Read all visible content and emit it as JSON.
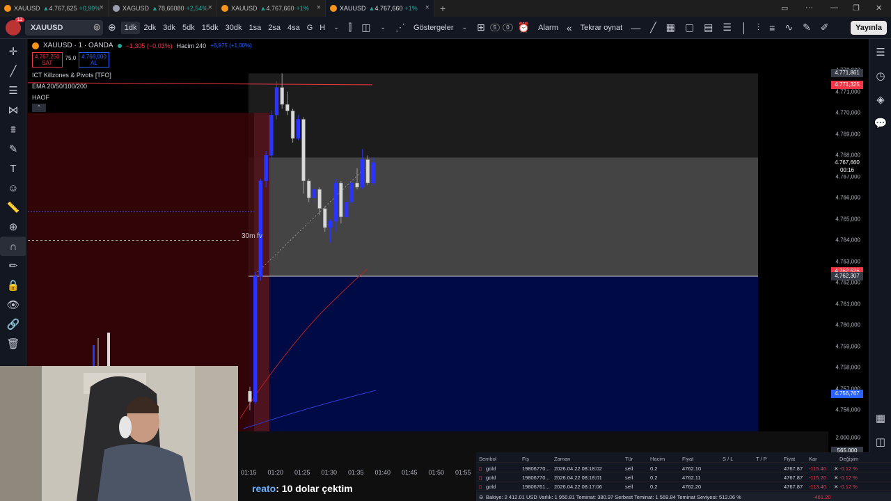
{
  "tabs": [
    {
      "symbol": "XAUUSD",
      "arrow": "▲",
      "price": "4.767,625",
      "change": "+0,99%",
      "active": false
    },
    {
      "symbol": "XAGUSD",
      "arrow": "▲",
      "price": "78,66080",
      "change": "+2,54%",
      "active": false
    },
    {
      "symbol": "XAUUSD",
      "arrow": "▲",
      "price": "4.767,660",
      "change": "+1%",
      "active": false
    },
    {
      "symbol": "XAUUSD",
      "arrow": "▲",
      "price": "4.767,660",
      "change": "+1%",
      "active": true
    }
  ],
  "toolbar": {
    "notification_count": "11",
    "symbol": "XAUUSD",
    "intervals": [
      "1dk",
      "2dk",
      "3dk",
      "5dk",
      "15dk",
      "30dk",
      "1sa",
      "2sa",
      "4sa",
      "G",
      "H"
    ],
    "selected_interval": "1dk",
    "indicators_label": "Göstergeler",
    "alarm_label": "Alarm",
    "replay_label": "Tekrar oynat",
    "counter_a": "5",
    "counter_b": "0",
    "publish_label": "Yayınla"
  },
  "legend": {
    "title": "XAUUSD · 1 · OANDA",
    "change": "−1,305 (−0,03%)",
    "volume_label": "Hacim",
    "volume_value": "240",
    "volume_extra": "+6,975 (+1,00%)",
    "bid_price": "4.767,250",
    "bid_label": "SAT",
    "spread": "75,0",
    "ask_price": "4.768,000",
    "ask_label": "AL",
    "indicators": [
      "ICT Killzones & Pivots [TFO]",
      "EMA 20/50/100/200",
      "HAOF"
    ]
  },
  "chart_annotation": "30m fv",
  "price_axis": {
    "ticks": [
      "4.772,000",
      "4.771,000",
      "4.770,000",
      "4.769,000",
      "4.768,000",
      "4.767,000",
      "4.766,000",
      "4.765,000",
      "4.764,000",
      "4.763,000",
      "4.762,000",
      "4.761,000",
      "4.760,000",
      "4.759,000",
      "4.758,000",
      "4.757,000",
      "4.756,000"
    ],
    "labels": [
      {
        "text": "4.771,861",
        "color": "#363a45"
      },
      {
        "text": "4.771,325",
        "color": "#f23645"
      },
      {
        "text": "4.767,660",
        "color": "#000000"
      },
      {
        "text": "00:16",
        "color": "#000000"
      },
      {
        "text": "4.762,526",
        "color": "#f23645"
      },
      {
        "text": "4.762,307",
        "color": "#363a45"
      },
      {
        "text": "4.756,767",
        "color": "#2962ff"
      }
    ],
    "volume_tick": "2.000,000",
    "volume_label": "565,000"
  },
  "time_axis": [
    "01:15",
    "01:20",
    "01:25",
    "01:30",
    "01:35",
    "01:40",
    "01:45",
    "01:50",
    "01:55"
  ],
  "chat": {
    "user": "reato",
    "message": ": 10 dolar çektim"
  },
  "positions": {
    "headers": [
      "Sembol",
      "Fiş",
      "Zaman",
      "Tür",
      "Hacim",
      "Fiyat",
      "S / L",
      "T / P",
      "Fiyat",
      "Kar",
      "Değişim"
    ],
    "rows": [
      [
        "gold",
        "19806770...",
        "2026.04.22 08:18:02",
        "sell",
        "0.2",
        "4762.10",
        "",
        "",
        "4767.87",
        "-115.40",
        "-0.12 %"
      ],
      [
        "gold",
        "19806770...",
        "2026.04.22 08:18:01",
        "sell",
        "0.2",
        "4762.11",
        "",
        "",
        "4767.87",
        "-115.20",
        "-0.12 %"
      ],
      [
        "gold",
        "19806761...",
        "2026.04.22 08:17:06",
        "sell",
        "0.2",
        "4762.20",
        "",
        "",
        "4767.87",
        "-113.40",
        "-0.12 %"
      ]
    ],
    "balance": "Bakiye: 2 412.01 USD  Varlık: 1 950.81  Teminat: 380.97  Serbest Teminat: 1 569.84  Teminat Seviyesi: 512.06 %",
    "total": "-461.20"
  },
  "chart_data": {
    "type": "candlestick",
    "symbol": "XAUUSD",
    "interval": "1",
    "x": [
      "01:15",
      "01:16",
      "01:17",
      "01:18",
      "01:19",
      "01:20",
      "01:21",
      "01:22",
      "01:23",
      "01:24",
      "01:25",
      "01:26",
      "01:27",
      "01:28",
      "01:29",
      "01:30",
      "01:31",
      "01:32",
      "01:33",
      "01:34",
      "01:35",
      "01:36",
      "01:37",
      "01:38"
    ],
    "candles": [
      {
        "o": 4756.9,
        "h": 4757.1,
        "l": 4756.0,
        "c": 4756.4
      },
      {
        "o": 4756.4,
        "h": 4762.5,
        "l": 4756.3,
        "c": 4762.3
      },
      {
        "o": 4762.3,
        "h": 4766.9,
        "l": 4762.1,
        "c": 4766.8
      },
      {
        "o": 4766.8,
        "h": 4768.2,
        "l": 4766.5,
        "c": 4768.0
      },
      {
        "o": 4768.0,
        "h": 4770.1,
        "l": 4767.8,
        "c": 4769.9
      },
      {
        "o": 4769.9,
        "h": 4771.5,
        "l": 4769.7,
        "c": 4771.2
      },
      {
        "o": 4771.2,
        "h": 4771.86,
        "l": 4770.2,
        "c": 4770.4
      },
      {
        "o": 4770.4,
        "h": 4771.0,
        "l": 4769.9,
        "c": 4770.1
      },
      {
        "o": 4770.1,
        "h": 4770.2,
        "l": 4768.6,
        "c": 4768.8
      },
      {
        "o": 4768.8,
        "h": 4769.9,
        "l": 4768.7,
        "c": 4769.7
      },
      {
        "o": 4769.7,
        "h": 4769.8,
        "l": 4766.2,
        "c": 4766.8
      },
      {
        "o": 4766.8,
        "h": 4766.9,
        "l": 4765.8,
        "c": 4766.0
      },
      {
        "o": 4766.0,
        "h": 4766.6,
        "l": 4765.7,
        "c": 4766.4
      },
      {
        "o": 4766.4,
        "h": 4766.5,
        "l": 4765.2,
        "c": 4765.5
      },
      {
        "o": 4765.5,
        "h": 4765.6,
        "l": 4764.4,
        "c": 4764.6
      },
      {
        "o": 4764.6,
        "h": 4765.0,
        "l": 4763.9,
        "c": 4764.9
      },
      {
        "o": 4764.9,
        "h": 4766.9,
        "l": 4764.4,
        "c": 4766.7
      },
      {
        "o": 4766.7,
        "h": 4766.8,
        "l": 4764.8,
        "c": 4765.1
      },
      {
        "o": 4765.1,
        "h": 4766.0,
        "l": 4765.0,
        "c": 4765.8
      },
      {
        "o": 4765.8,
        "h": 4766.8,
        "l": 4765.7,
        "c": 4766.7
      },
      {
        "o": 4766.7,
        "h": 4767.4,
        "l": 4766.4,
        "c": 4766.5
      },
      {
        "o": 4766.5,
        "h": 4768.3,
        "l": 4766.4,
        "c": 4767.8
      },
      {
        "o": 4767.8,
        "h": 4768.0,
        "l": 4766.6,
        "c": 4766.7
      },
      {
        "o": 4766.7,
        "h": 4767.9,
        "l": 4766.6,
        "c": 4767.66
      }
    ],
    "ylim": [
      4755.0,
      4772.5
    ],
    "zones": [
      {
        "name": "upper-range",
        "y_top": 4771.861,
        "y_bottom": 4767.9,
        "color": "#1c1c1c"
      },
      {
        "name": "mid-range",
        "y_top": 4767.9,
        "y_bottom": 4762.307,
        "color": "#444444"
      },
      {
        "name": "lower-range",
        "y_top": 4762.307,
        "y_bottom": 4755.0,
        "color": "#000b45"
      },
      {
        "name": "red-box",
        "y_top": 4770.0,
        "y_bottom": 4755.0,
        "color": "#3a0508"
      }
    ],
    "lines": [
      {
        "name": "red-level",
        "y": 4771.325,
        "color": "#f23645"
      },
      {
        "name": "white-level",
        "y": 4762.307,
        "color": "#d1d4dc"
      },
      {
        "name": "fvg-dashed",
        "y": 4764.0,
        "color": "#d1d4dc"
      }
    ]
  }
}
